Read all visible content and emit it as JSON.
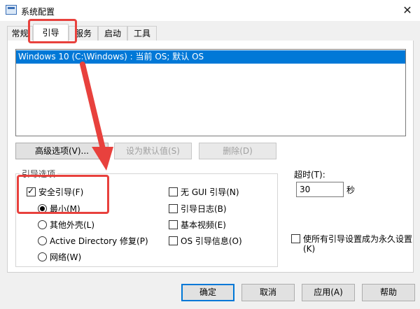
{
  "window": {
    "title": "系统配置",
    "close_glyph": "✕"
  },
  "tabs": [
    {
      "label": "常规",
      "active": false
    },
    {
      "label": "引导",
      "active": true
    },
    {
      "label": "服务",
      "active": false
    },
    {
      "label": "启动",
      "active": false
    },
    {
      "label": "工具",
      "active": false
    }
  ],
  "boot_list": {
    "entries": [
      "Windows 10 (C:\\Windows) : 当前 OS; 默认 OS"
    ]
  },
  "action_buttons": {
    "advanced": "高级选项(V)...",
    "set_default": "设为默认值(S)",
    "delete": "删除(D)"
  },
  "boot_options": {
    "legend": "引导选项",
    "safe_boot": {
      "label": "安全引导(F)",
      "checked": true
    },
    "radios": [
      {
        "label": "最小(M)",
        "checked": true
      },
      {
        "label": "其他外壳(L)",
        "checked": false
      },
      {
        "label": "Active Directory 修复(P)",
        "checked": false
      },
      {
        "label": "网络(W)",
        "checked": false
      }
    ],
    "right_checks": [
      {
        "label": "无 GUI 引导(N)",
        "checked": false
      },
      {
        "label": "引导日志(B)",
        "checked": false
      },
      {
        "label": "基本视频(E)",
        "checked": false
      },
      {
        "label": "OS 引导信息(O)",
        "checked": false
      }
    ]
  },
  "timeout": {
    "label": "超时(T):",
    "value": "30",
    "unit": "秒"
  },
  "permanent": {
    "label_line1": "使所有引导设置成为永久设置",
    "label_line2": "(K)",
    "checked": false
  },
  "footer": {
    "ok": "确定",
    "cancel": "取消",
    "apply": "应用(A)",
    "help": "帮助"
  },
  "annotation_color": "#e8413d"
}
